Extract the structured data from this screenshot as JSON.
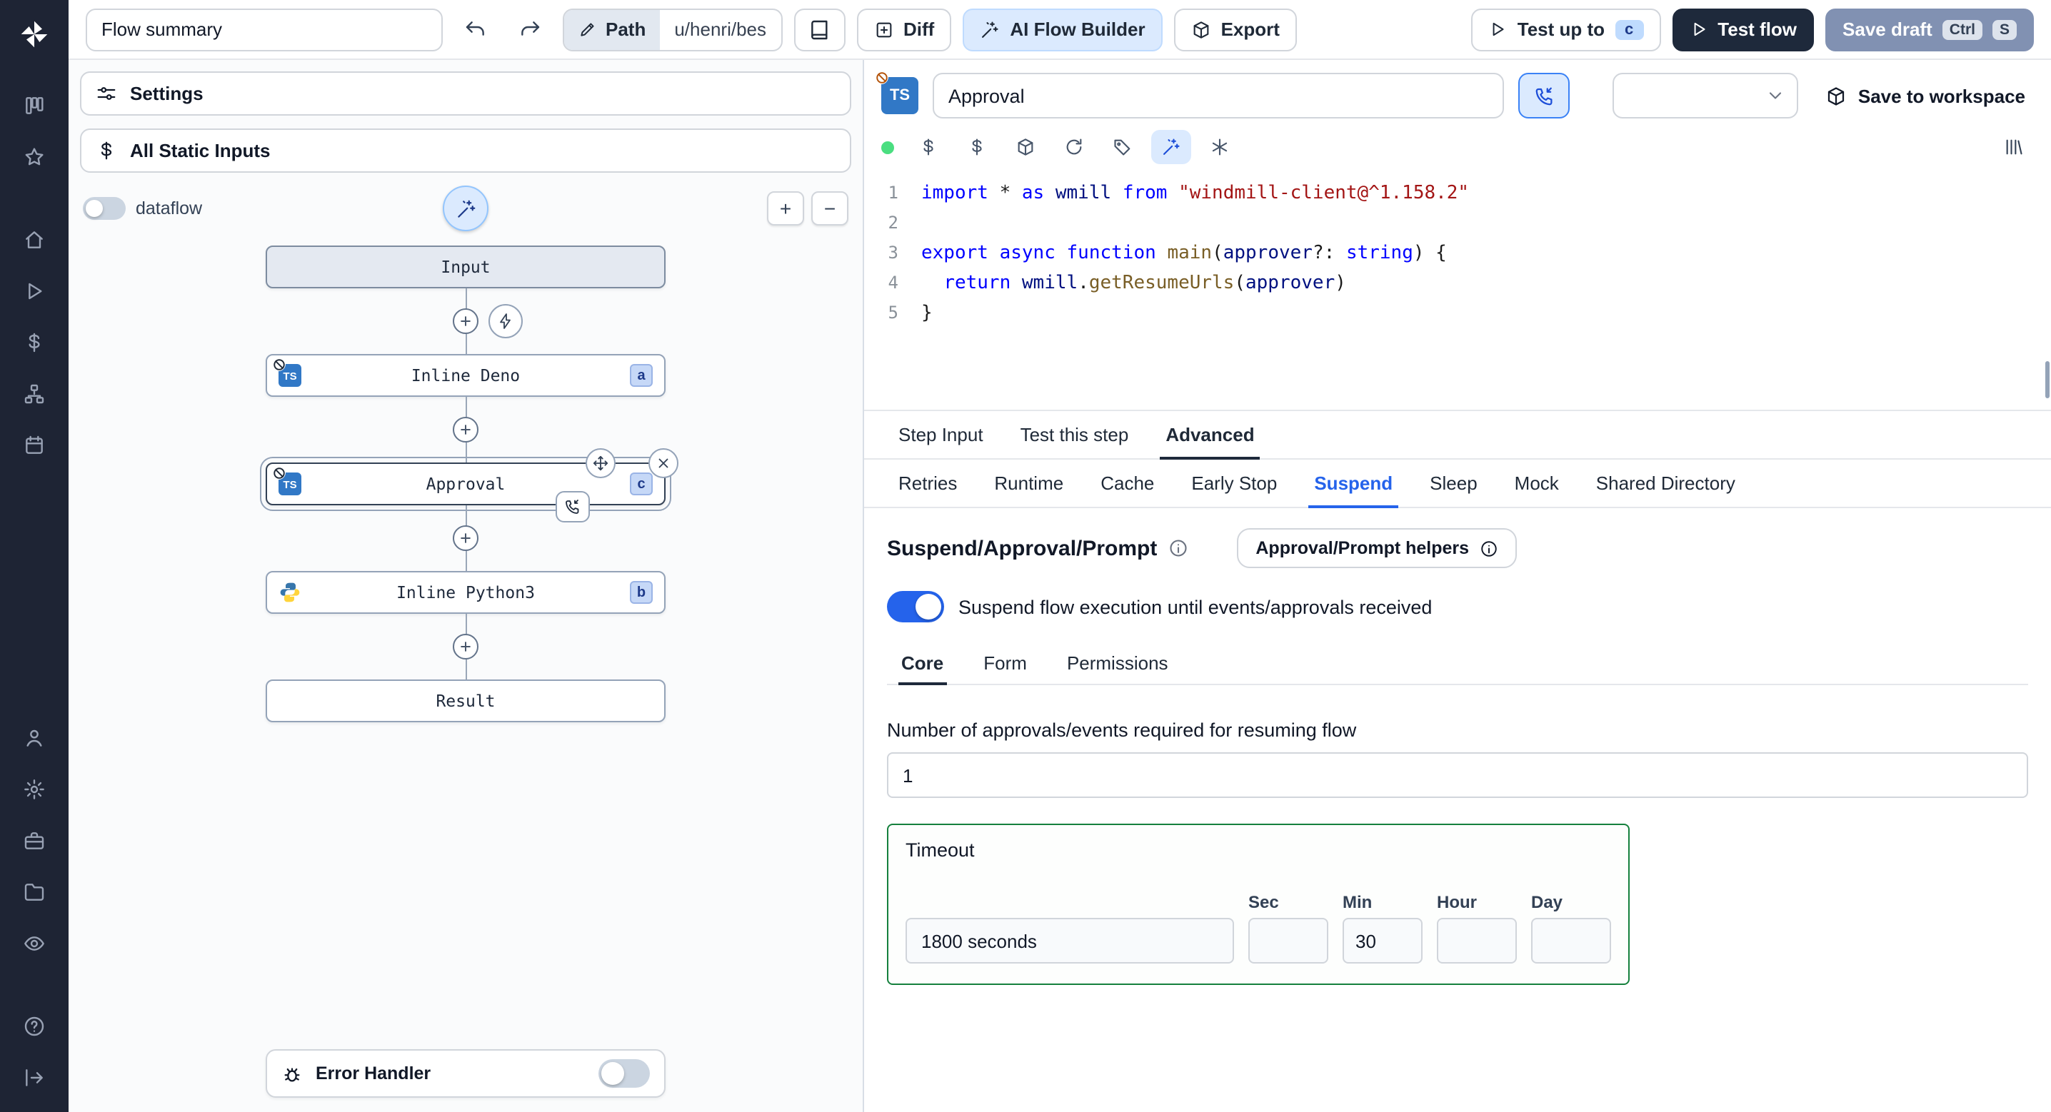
{
  "topbar": {
    "flow_summary": "Flow summary",
    "path_label": "Path",
    "path_value": "u/henri/bes",
    "diff_label": "Diff",
    "ai_flow_builder_label": "AI Flow Builder",
    "export_label": "Export",
    "test_up_to_label": "Test up to",
    "test_up_to_badge": "c",
    "test_flow_label": "Test flow",
    "save_draft_label": "Save draft",
    "save_draft_kbd": [
      "Ctrl",
      "S"
    ]
  },
  "left": {
    "settings_label": "Settings",
    "static_inputs_label": "All Static Inputs",
    "dataflow_label": "dataflow",
    "zoom_in": "+",
    "zoom_out": "−",
    "error_handler_label": "Error Handler"
  },
  "graph": {
    "ts_label": "TS",
    "input_label": "Input",
    "steps": [
      {
        "label": "Inline Deno",
        "badge": "a",
        "language": "typescript"
      },
      {
        "label": "Approval",
        "badge": "c",
        "language": "typescript",
        "selected": true
      },
      {
        "label": "Inline Python3",
        "badge": "b",
        "language": "python"
      }
    ],
    "result_label": "Result"
  },
  "editor": {
    "step_name": "Approval",
    "save_to_workspace_label": "Save to workspace",
    "tabs": [
      "Step Input",
      "Test this step",
      "Advanced"
    ],
    "active_tab": "Advanced",
    "advanced_tabs": [
      "Retries",
      "Runtime",
      "Cache",
      "Early Stop",
      "Suspend",
      "Sleep",
      "Mock",
      "Shared Directory"
    ],
    "active_advanced_tab": "Suspend",
    "code_lines": [
      {
        "n": "1",
        "t": [
          {
            "s": "import",
            "c": "kw"
          },
          {
            "s": " ",
            "c": "pl"
          },
          {
            "s": "*",
            "c": "pl"
          },
          {
            "s": " ",
            "c": "pl"
          },
          {
            "s": "as",
            "c": "kw"
          },
          {
            "s": " ",
            "c": "pl"
          },
          {
            "s": "wmill",
            "c": "id"
          },
          {
            "s": " ",
            "c": "pl"
          },
          {
            "s": "from",
            "c": "kw"
          },
          {
            "s": " ",
            "c": "pl"
          },
          {
            "s": "\"windmill-client@^1.158.2\"",
            "c": "str"
          }
        ]
      },
      {
        "n": "2",
        "t": []
      },
      {
        "n": "3",
        "t": [
          {
            "s": "export",
            "c": "kw"
          },
          {
            "s": " ",
            "c": "pl"
          },
          {
            "s": "async",
            "c": "kw"
          },
          {
            "s": " ",
            "c": "pl"
          },
          {
            "s": "function",
            "c": "kw"
          },
          {
            "s": " ",
            "c": "pl"
          },
          {
            "s": "main",
            "c": "fn"
          },
          {
            "s": "(",
            "c": "pl"
          },
          {
            "s": "approver",
            "c": "id"
          },
          {
            "s": "?: ",
            "c": "pl"
          },
          {
            "s": "string",
            "c": "kw"
          },
          {
            "s": ") {",
            "c": "pl"
          }
        ]
      },
      {
        "n": "4",
        "t": [
          {
            "s": "  ",
            "c": "pl"
          },
          {
            "s": "return",
            "c": "kw"
          },
          {
            "s": " ",
            "c": "pl"
          },
          {
            "s": "wmill",
            "c": "id"
          },
          {
            "s": ".",
            "c": "pl"
          },
          {
            "s": "getResumeUrls",
            "c": "fn"
          },
          {
            "s": "(",
            "c": "pl"
          },
          {
            "s": "approver",
            "c": "id"
          },
          {
            "s": ")",
            "c": "pl"
          }
        ]
      },
      {
        "n": "5",
        "t": [
          {
            "s": "}",
            "c": "pl"
          }
        ]
      }
    ]
  },
  "suspend": {
    "title": "Suspend/Approval/Prompt",
    "helpers_label": "Approval/Prompt helpers",
    "toggle_label": "Suspend flow execution until events/approvals received",
    "toggle_on": true,
    "tabs": [
      "Core",
      "Form",
      "Permissions"
    ],
    "active_tab": "Core",
    "approvals_label": "Number of approvals/events required for resuming flow",
    "approvals_value": "1",
    "timeout": {
      "label": "Timeout",
      "value": "1800 seconds",
      "fields": [
        {
          "label": "Sec",
          "value": ""
        },
        {
          "label": "Min",
          "value": "30"
        },
        {
          "label": "Hour",
          "value": ""
        },
        {
          "label": "Day",
          "value": ""
        }
      ]
    }
  },
  "colors": {
    "accent": "#2563eb",
    "rail_bg": "#1e2434",
    "dark_button": "#1e293b",
    "save_draft_button": "#8191b2",
    "timeout_border": "#15803d",
    "status_green": "#4ade80",
    "ts_blue": "#3178c6",
    "light_blue_bg": "#dbeafe"
  }
}
